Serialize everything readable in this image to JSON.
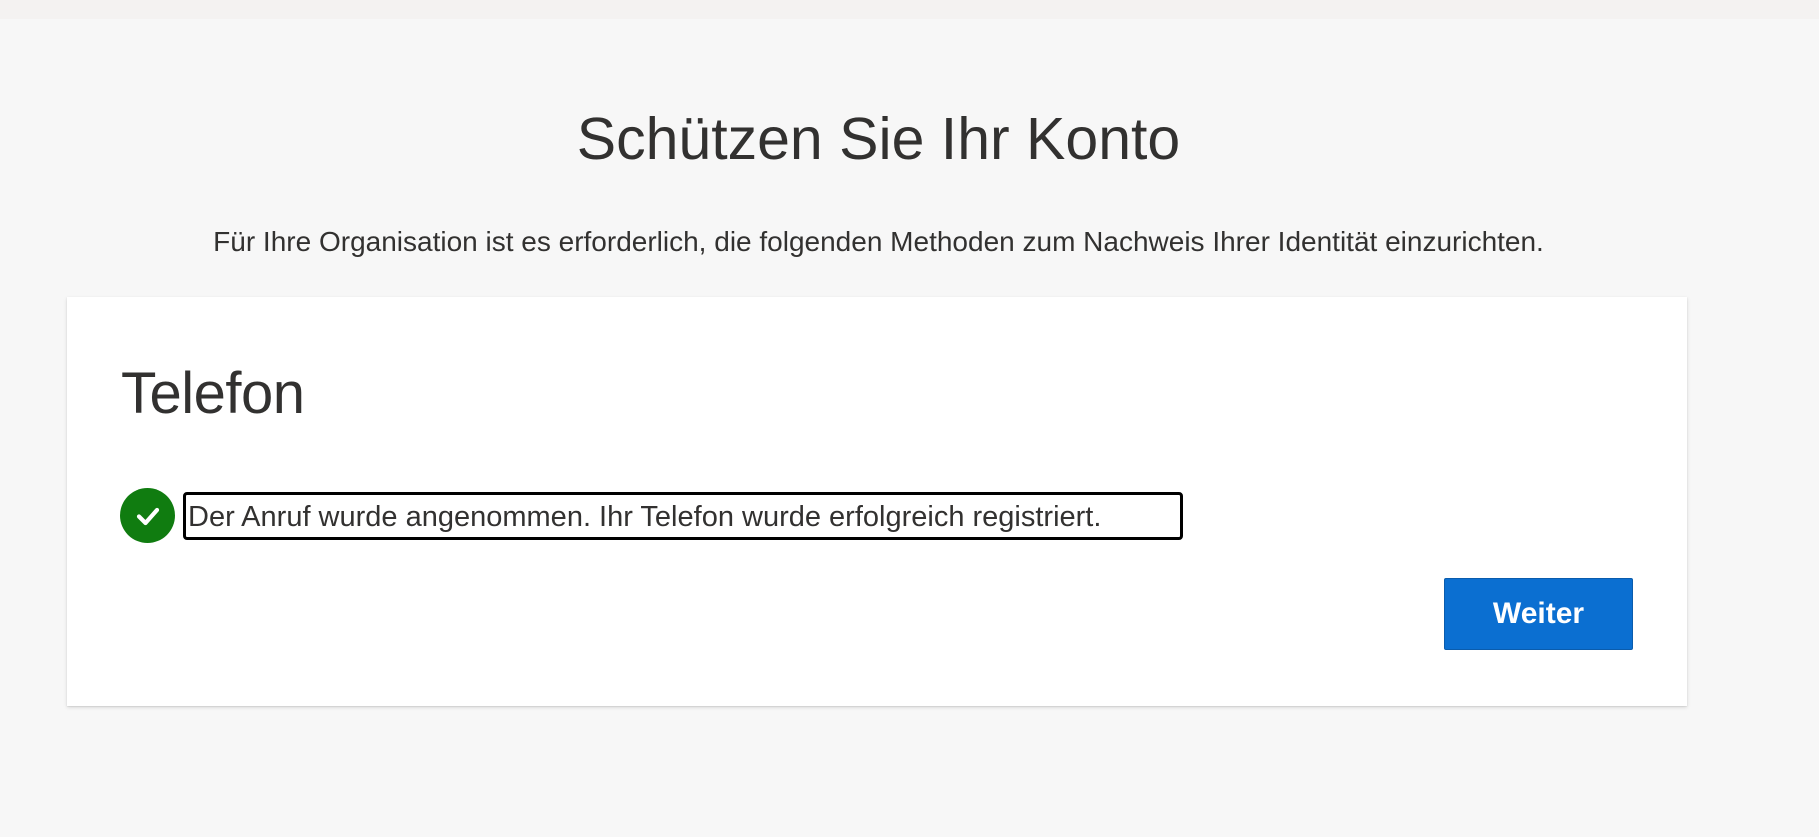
{
  "page": {
    "title": "Schützen Sie Ihr Konto",
    "subtitle": "Für Ihre Organisation ist es erforderlich, die folgenden Methoden zum Nachweis Ihrer Identität einzurichten."
  },
  "card": {
    "title": "Telefon",
    "status": {
      "icon": "checkmark-circle-icon",
      "message": "Der Anruf wurde angenommen. Ihr Telefon wurde erfolgreich registriert."
    },
    "next_button_label": "Weiter"
  },
  "colors": {
    "background": "#f7f7f7",
    "card": "#ffffff",
    "success": "#107c10",
    "primary": "#0b6fd1",
    "text": "#323130"
  }
}
